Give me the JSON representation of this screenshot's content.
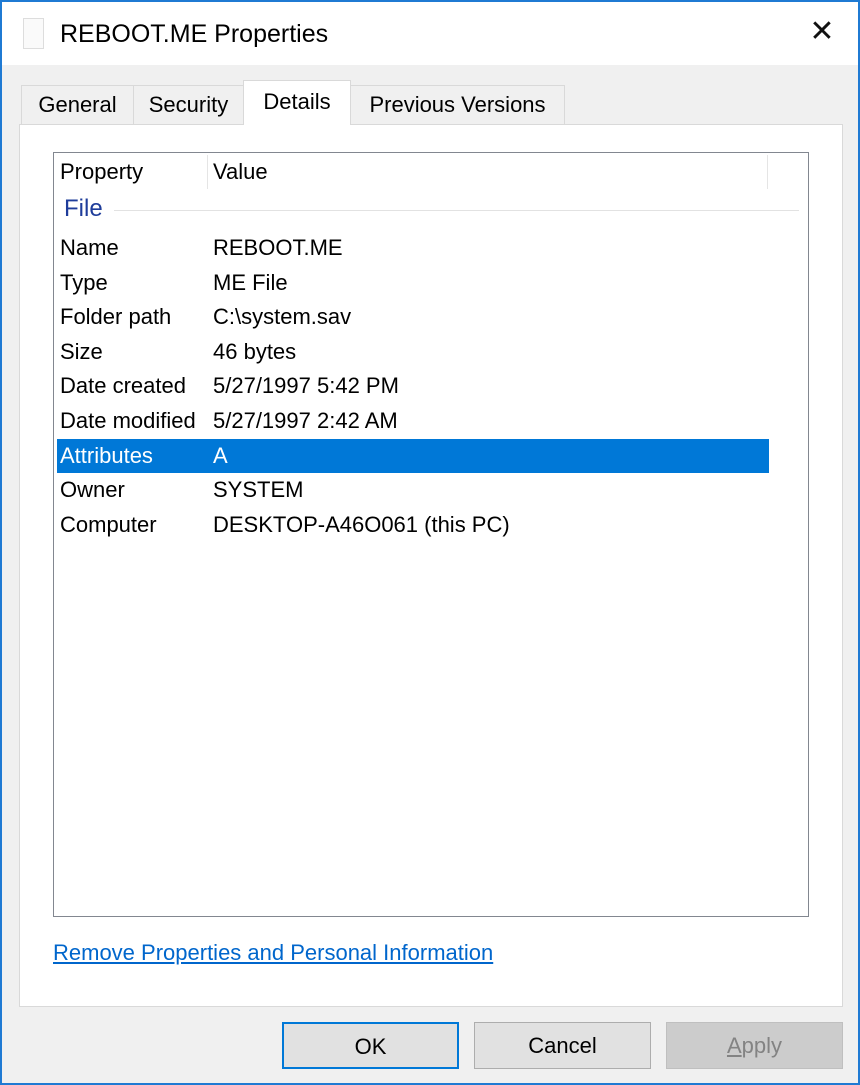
{
  "window": {
    "title": "REBOOT.ME Properties",
    "accent": "#0078d7"
  },
  "tabs": [
    {
      "label": "General"
    },
    {
      "label": "Security"
    },
    {
      "label": "Details"
    },
    {
      "label": "Previous Versions"
    }
  ],
  "list": {
    "columns": [
      "Property",
      "Value"
    ],
    "group": "File",
    "rows": [
      {
        "property": "Name",
        "value": "REBOOT.ME"
      },
      {
        "property": "Type",
        "value": "ME File"
      },
      {
        "property": "Folder path",
        "value": "C:\\system.sav"
      },
      {
        "property": "Size",
        "value": "46 bytes"
      },
      {
        "property": "Date created",
        "value": "5/27/1997 5:42 PM"
      },
      {
        "property": "Date modified",
        "value": "5/27/1997 2:42 AM"
      },
      {
        "property": "Attributes",
        "value": "A",
        "selected": true
      },
      {
        "property": "Owner",
        "value": "SYSTEM"
      },
      {
        "property": "Computer",
        "value": "DESKTOP-A46O061 (this PC)"
      }
    ]
  },
  "link": "Remove Properties and Personal Information",
  "buttons": {
    "ok": "OK",
    "cancel": "Cancel",
    "apply": "Apply"
  }
}
